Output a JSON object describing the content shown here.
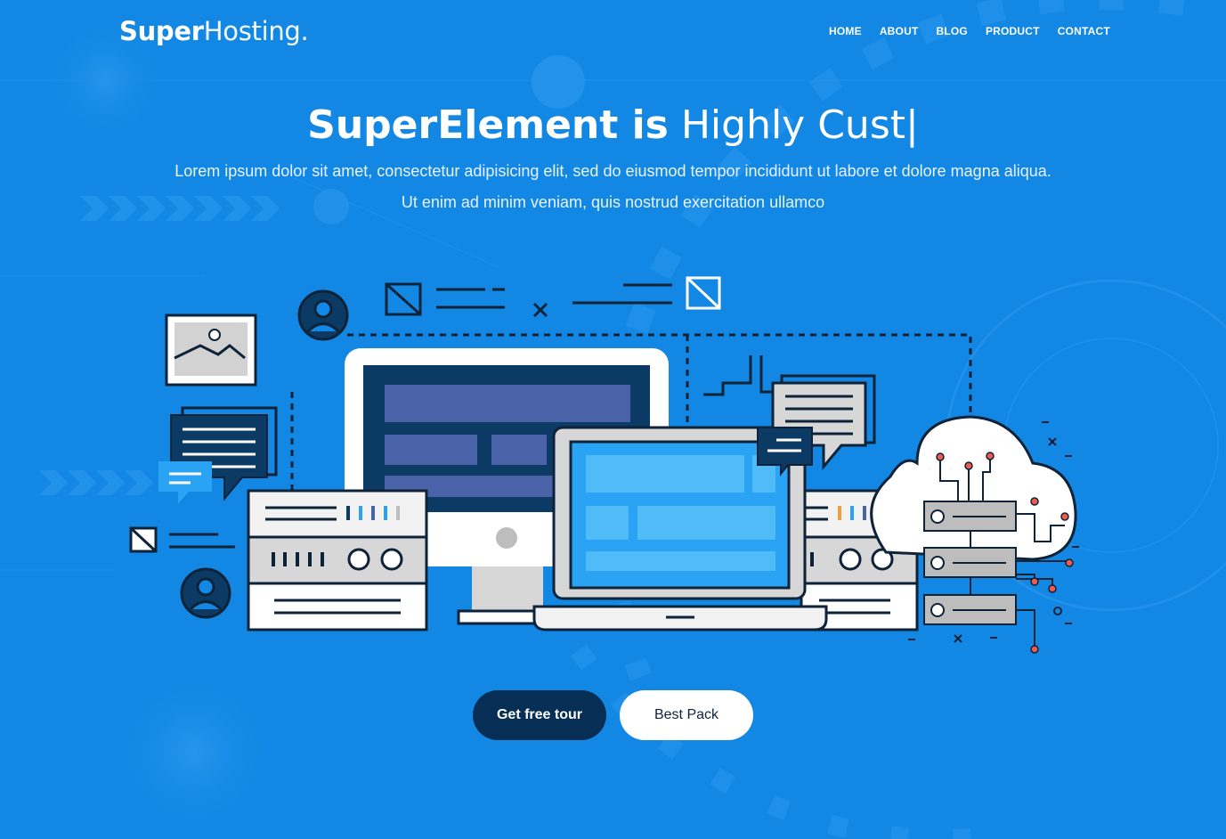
{
  "brand": {
    "bold": "Super",
    "light": "Hosting."
  },
  "nav": [
    "HOME",
    "ABOUT",
    "BLOG",
    "PRODUCT",
    "CONTACT"
  ],
  "hero": {
    "title_bold": "SuperElement is",
    "title_typed": " Highly Cust|",
    "subtitle_line1": "Lorem ipsum dolor sit amet, consectetur adipisicing elit, sed do eiusmod tempor incididunt ut labore et dolore magna aliqua.",
    "subtitle_line2": "Ut enim ad minim veniam, quis nostrud exercitation ullamco"
  },
  "buttons": {
    "primary": "Get free tour",
    "secondary": "Best Pack"
  },
  "colors": {
    "background": "#1288e4",
    "dark_navy": "#072f55",
    "screen_blue": "#2aa3f5",
    "monitor_screen": "#0b3a64",
    "panel_gray": "#d7d7d7",
    "accent_orange": "#f2a13a"
  }
}
